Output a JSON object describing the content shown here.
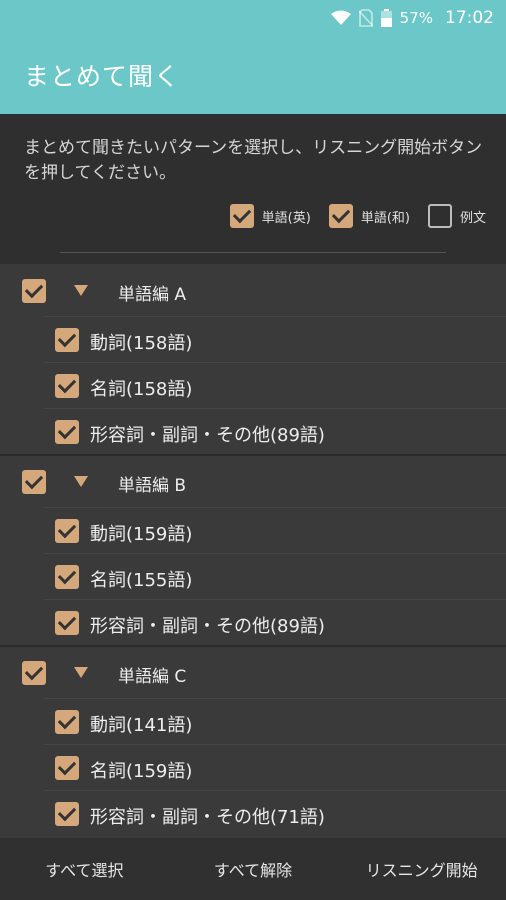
{
  "status": {
    "battery": "57%",
    "time": "17:02"
  },
  "appbar": {
    "title": "まとめて聞く"
  },
  "description": "まとめて聞きたいパターンを選択し、リスニング開始ボタンを押してください。",
  "options": [
    {
      "label": "単語(英)",
      "checked": true
    },
    {
      "label": "単語(和)",
      "checked": true
    },
    {
      "label": "例文",
      "checked": false
    }
  ],
  "groups": [
    {
      "label": "単語編 A",
      "checked": true,
      "items": [
        {
          "label": "動詞(158語)",
          "checked": true
        },
        {
          "label": "名詞(158語)",
          "checked": true
        },
        {
          "label": "形容詞・副詞・その他(89語)",
          "checked": true
        }
      ]
    },
    {
      "label": "単語編 B",
      "checked": true,
      "items": [
        {
          "label": "動詞(159語)",
          "checked": true
        },
        {
          "label": "名詞(155語)",
          "checked": true
        },
        {
          "label": "形容詞・副詞・その他(89語)",
          "checked": true
        }
      ]
    },
    {
      "label": "単語編 C",
      "checked": true,
      "items": [
        {
          "label": "動詞(141語)",
          "checked": true
        },
        {
          "label": "名詞(159語)",
          "checked": true
        },
        {
          "label": "形容詞・副詞・その他(71語)",
          "checked": true
        }
      ]
    }
  ],
  "bottom": {
    "select_all": "すべて選択",
    "deselect_all": "すべて解除",
    "start": "リスニング開始"
  },
  "colors": {
    "accent": "#6cc8c8",
    "checkbox": "#d4a87a"
  }
}
